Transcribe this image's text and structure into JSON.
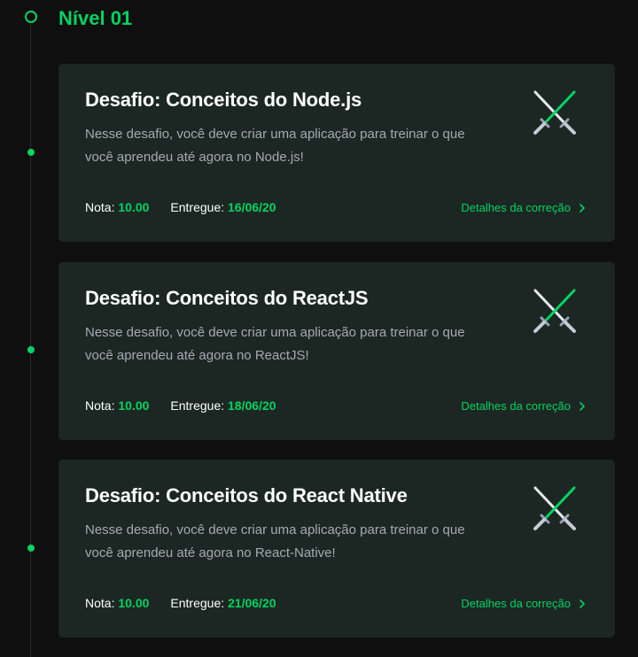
{
  "level": {
    "title": "Nível 01"
  },
  "cards": [
    {
      "title": "Desafio: Conceitos do Node.js",
      "description": "Nesse desafio, você deve criar uma aplicação para treinar o que você aprendeu até agora no Node.js!",
      "grade_label": "Nota:",
      "grade_value": "10.00",
      "delivered_label": "Entregue:",
      "delivered_value": "16/06/20",
      "details_link": "Detalhes da correção",
      "icon": "swords-icon"
    },
    {
      "title": "Desafio: Conceitos do ReactJS",
      "description": "Nesse desafio, você deve criar uma aplicação para treinar o que você aprendeu até agora no ReactJS!",
      "grade_label": "Nota:",
      "grade_value": "10.00",
      "delivered_label": "Entregue:",
      "delivered_value": "18/06/20",
      "details_link": "Detalhes da correção",
      "icon": "swords-icon"
    },
    {
      "title": "Desafio: Conceitos do React Native",
      "description": "Nesse desafio, você deve criar uma aplicação para treinar o que você aprendeu até agora no React-Native!",
      "grade_label": "Nota:",
      "grade_value": "10.00",
      "delivered_label": "Entregue:",
      "delivered_value": "21/06/20",
      "details_link": "Detalhes da correção",
      "icon": "swords-icon"
    }
  ],
  "colors": {
    "accent": "#04d361",
    "background": "#0f0f10",
    "card": "#1c2723",
    "muted_text": "#a8a8b3"
  }
}
